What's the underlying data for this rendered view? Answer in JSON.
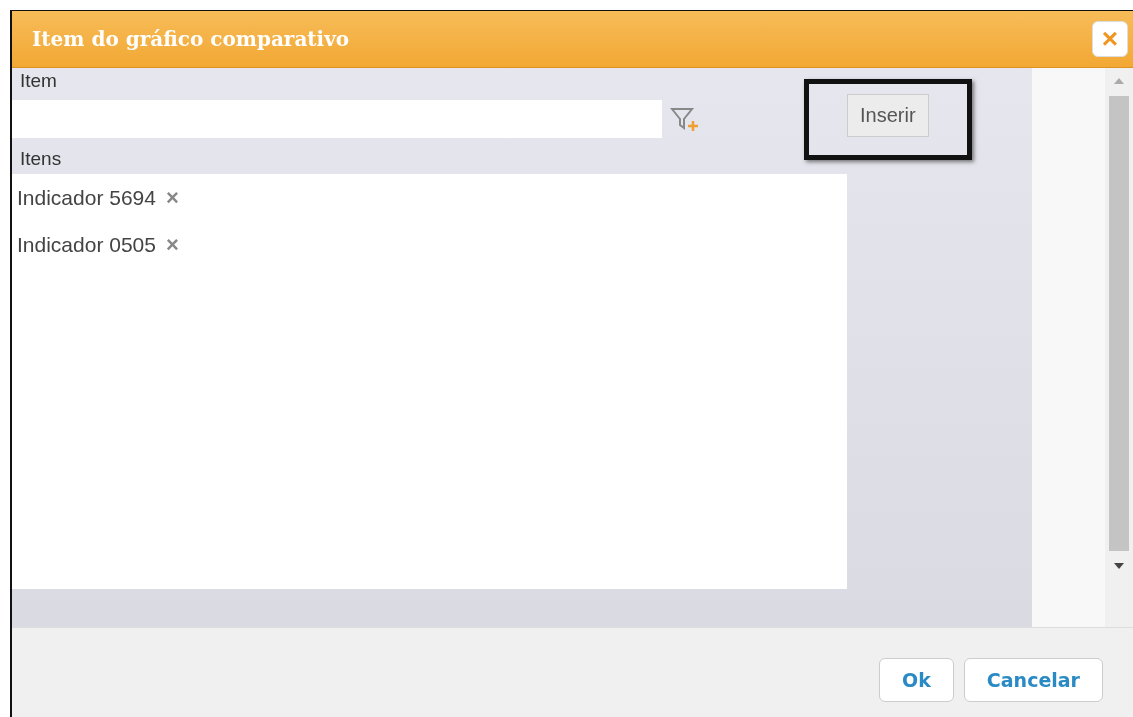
{
  "dialog": {
    "title": "Item do gráfico comparativo",
    "close_label": "×"
  },
  "item_field": {
    "label": "Item"
  },
  "insert_button": {
    "label": "Inserir",
    "highlighted": true
  },
  "list": {
    "label": "Itens",
    "items": [
      {
        "label": "Indicador 5694",
        "remove_label": "×"
      },
      {
        "label": "Indicador 0505",
        "remove_label": "×"
      }
    ]
  },
  "buttons": [
    {
      "label": "Ok"
    },
    {
      "label": "Cancelar"
    }
  ]
}
